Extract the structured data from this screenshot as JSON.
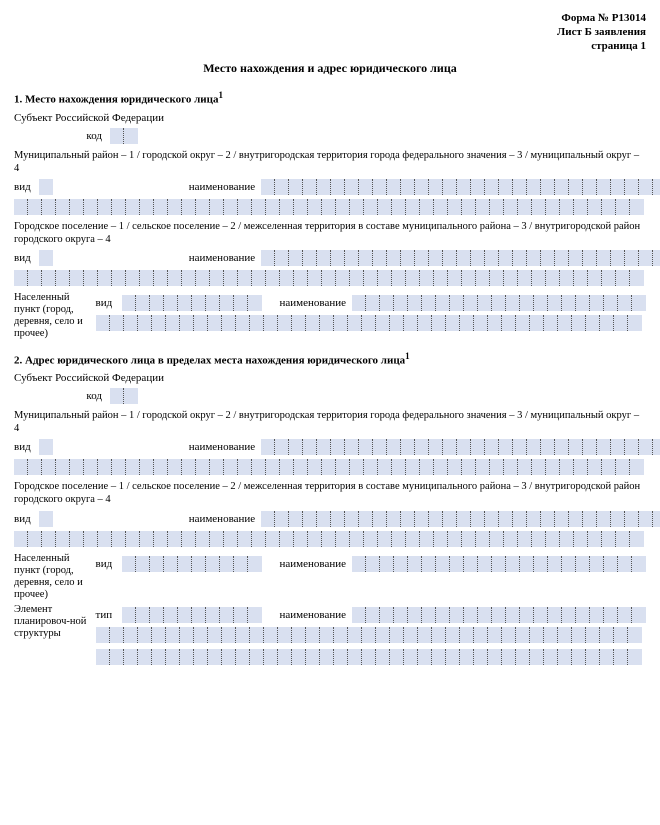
{
  "header": {
    "form_no": "Форма № Р13014",
    "sheet": "Лист Б заявления",
    "page": "страница 1"
  },
  "title": "Место нахождения и адрес юридического лица",
  "s1": {
    "heading": "1. Место нахождения юридического лица",
    "subject": "Субъект Российской Федерации",
    "code": "код",
    "mun_note": "Муниципальный район – 1 / городской округ – 2 / внутригородская территория города федерального значения – 3 / муниципальный округ – 4",
    "vid": "вид",
    "naim": "наименование",
    "gp_note": "Городское поселение – 1 / сельское поселение – 2 / межселенная территория в составе муниципального района – 3 / внутригородской район городского округа – 4",
    "np_label": "Населенный пункт (город, деревня, село и прочее)"
  },
  "s2": {
    "heading": "2. Адрес юридического лица в пределах места нахождения юридического лица",
    "subject": "Субъект Российской Федерации",
    "code": "код",
    "mun_note": "Муниципальный район – 1 / городской округ – 2 / внутригородская территория города федерального значения – 3 / муниципальный округ – 4",
    "vid": "вид",
    "naim": "наименование",
    "gp_note": "Городское поселение – 1 / сельское поселение – 2 / межселенная территория в составе муниципального района – 3 / внутригородской район городского округа – 4",
    "np_label": "Населенный пункт (город, деревня, село и прочее)",
    "plan_label": "Элемент планировоч-ной структуры",
    "tip": "тип"
  }
}
